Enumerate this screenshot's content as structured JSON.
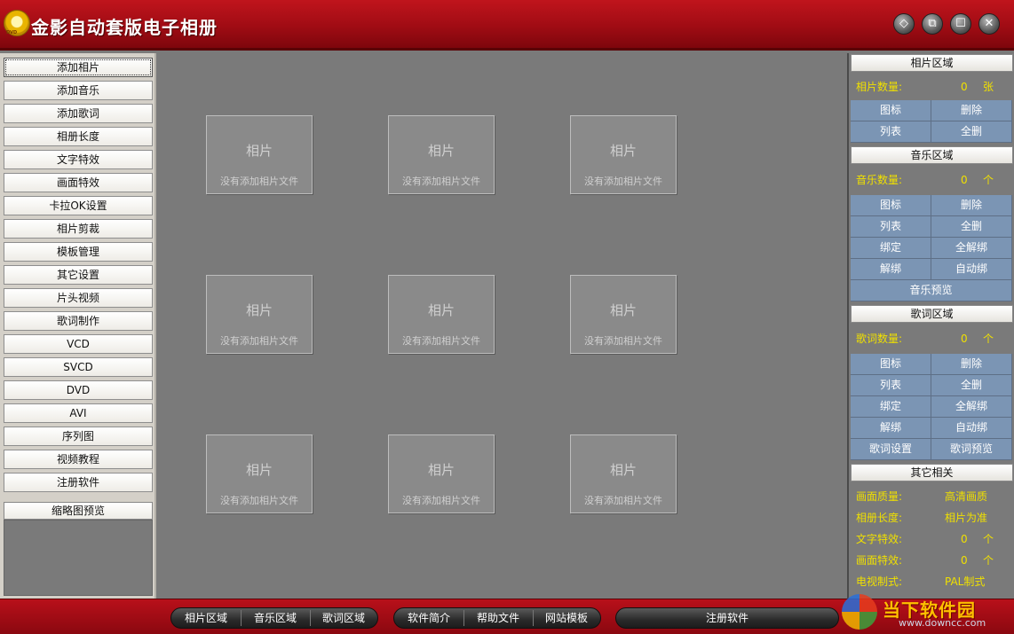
{
  "title": {
    "app_name": "金影自动套版电子相册",
    "logo_text": "DVD",
    "buttons": [
      "◇",
      "⧉",
      "☐",
      "✕"
    ]
  },
  "left_nav": [
    "添加相片",
    "添加音乐",
    "添加歌词",
    "相册长度",
    "文字特效",
    "画面特效",
    "卡拉OK设置",
    "相片剪裁",
    "模板管理",
    "其它设置",
    "片头视频",
    "歌词制作",
    "VCD",
    "SVCD",
    "DVD",
    "AVI",
    "序列图",
    "视频教程",
    "注册软件"
  ],
  "thumbnail_preview": "缩略图预览",
  "photo_slot": {
    "title": "相片",
    "desc": "没有添加相片文件"
  },
  "photo_area": {
    "header": "相片区域",
    "count_label": "相片数量:",
    "count_value": "0",
    "count_unit": "张",
    "buttons": [
      "图标",
      "删除",
      "列表",
      "全删"
    ]
  },
  "music_area": {
    "header": "音乐区域",
    "count_label": "音乐数量:",
    "count_value": "0",
    "count_unit": "个",
    "buttons": [
      "图标",
      "删除",
      "列表",
      "全删",
      "绑定",
      "全解绑",
      "解绑",
      "自动绑"
    ],
    "preview": "音乐预览"
  },
  "lyric_area": {
    "header": "歌词区域",
    "count_label": "歌词数量:",
    "count_value": "0",
    "count_unit": "个",
    "buttons": [
      "图标",
      "删除",
      "列表",
      "全删",
      "绑定",
      "全解绑",
      "解绑",
      "自动绑",
      "歌词设置",
      "歌词预览"
    ]
  },
  "other_area": {
    "header": "其它相关",
    "rows": [
      {
        "label": "画面质量:",
        "value": "高清画质",
        "unit": ""
      },
      {
        "label": "相册长度:",
        "value": "相片为准",
        "unit": ""
      },
      {
        "label": "文字特效:",
        "value": "0",
        "unit": "个"
      },
      {
        "label": "画面特效:",
        "value": "0",
        "unit": "个"
      },
      {
        "label": "电视制式:",
        "value": "PAL制式",
        "unit": ""
      }
    ]
  },
  "bottom_bar": {
    "group1": [
      "相片区域",
      "音乐区域",
      "歌词区域"
    ],
    "group2": [
      "软件简介",
      "帮助文件",
      "网站模板"
    ],
    "register": "注册软件"
  },
  "watermark": {
    "text": "当下软件园",
    "url": "www.downcc.com"
  },
  "colors": {
    "title_red": "#a00c14",
    "bottom_red": "#8a0810",
    "panel_gray": "#7a7a7a",
    "grid_blue": "#7b95b4",
    "count_yellow": "#f0e000"
  }
}
